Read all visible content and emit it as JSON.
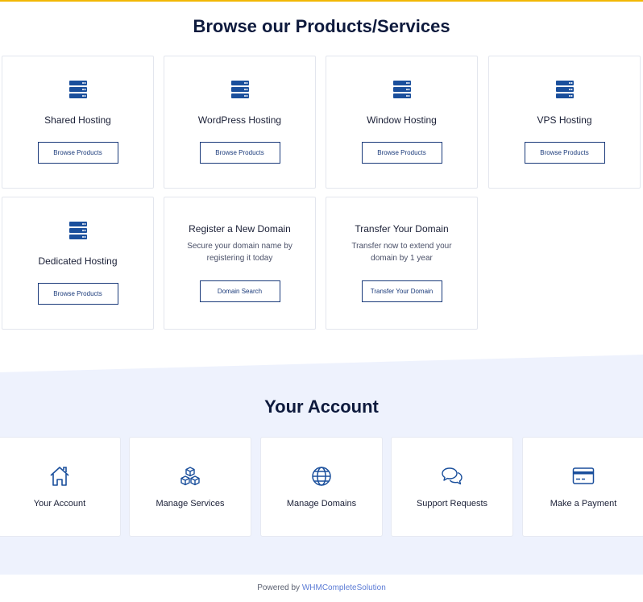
{
  "products": {
    "title": "Browse our Products/Services",
    "items": [
      {
        "name": "Shared Hosting",
        "button": "Browse Products"
      },
      {
        "name": "WordPress Hosting",
        "button": "Browse Products"
      },
      {
        "name": "Window Hosting",
        "button": "Browse Products"
      },
      {
        "name": "VPS Hosting",
        "button": "Browse Products"
      },
      {
        "name": "Dedicated Hosting",
        "button": "Browse Products"
      },
      {
        "name": "Register a New Domain",
        "description": "Secure your domain name by registering it today",
        "button": "Domain Search"
      },
      {
        "name": "Transfer Your Domain",
        "description": "Transfer now to extend your domain by 1 year",
        "button": "Transfer Your Domain"
      }
    ]
  },
  "account": {
    "title": "Your Account",
    "items": [
      {
        "label": "Your Account",
        "icon": "home-icon"
      },
      {
        "label": "Manage Services",
        "icon": "cubes-icon"
      },
      {
        "label": "Manage Domains",
        "icon": "globe-icon"
      },
      {
        "label": "Support Requests",
        "icon": "chat-bubbles-icon"
      },
      {
        "label": "Make a Payment",
        "icon": "credit-card-icon"
      }
    ]
  },
  "footer": {
    "prefix": "Powered by ",
    "link": "WHMCompleteSolution"
  },
  "colors": {
    "accent_bar": "#f2b705",
    "icon_blue": "#1a4f9c",
    "title": "#0e1a3d",
    "account_bg": "#eef2fd"
  }
}
